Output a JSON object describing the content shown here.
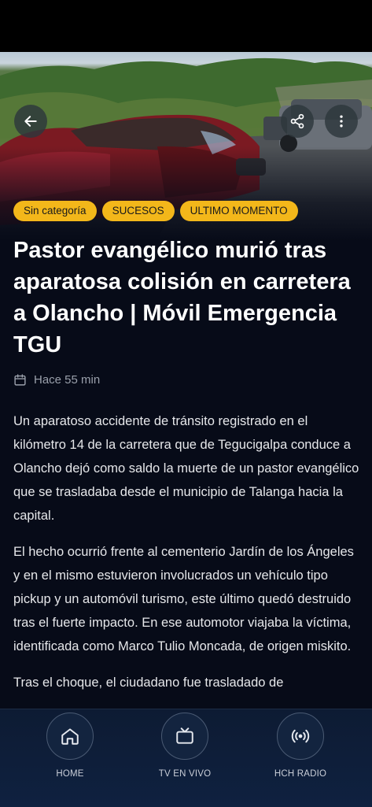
{
  "article": {
    "tags": [
      "Sin categoría",
      "SUCESOS",
      "ULTIMO MOMENTO"
    ],
    "title": "Pastor evangélico murió tras aparatosa colisión en carretera a Olancho | Móvil Emergencia TGU",
    "time_ago": "Hace 55 min",
    "paragraphs": [
      "Un aparatoso accidente de tránsito registrado en el kilómetro 14 de la carretera que de Tegucigalpa conduce a Olancho dejó como saldo la muerte de un pastor evangélico que se trasladaba desde el municipio de Talanga hacia la capital.",
      "El hecho ocurrió frente al cementerio Jardín de los Ángeles y en el mismo estuvieron involucrados un vehículo tipo pickup y un automóvil turismo, este último quedó destruido tras el fuerte impacto. En ese automotor viajaba la víctima, identificada como Marco Tulio Moncada, de origen miskito.",
      "Tras el choque, el ciudadano fue trasladado de"
    ]
  },
  "icons": {
    "back": "arrow-left-icon",
    "share": "share-icon",
    "more": "more-vertical-icon",
    "calendar": "calendar-icon",
    "home": "home-icon",
    "tv": "tv-icon",
    "radio": "radio-broadcast-icon"
  },
  "bottom_nav": {
    "home_label": "HOME",
    "tv_label": "TV EN VIVO",
    "radio_label": "HCH RADIO"
  },
  "colors": {
    "tag_bg": "#f3b71a",
    "background": "#070b18",
    "nav_bg": "#0f2140"
  }
}
